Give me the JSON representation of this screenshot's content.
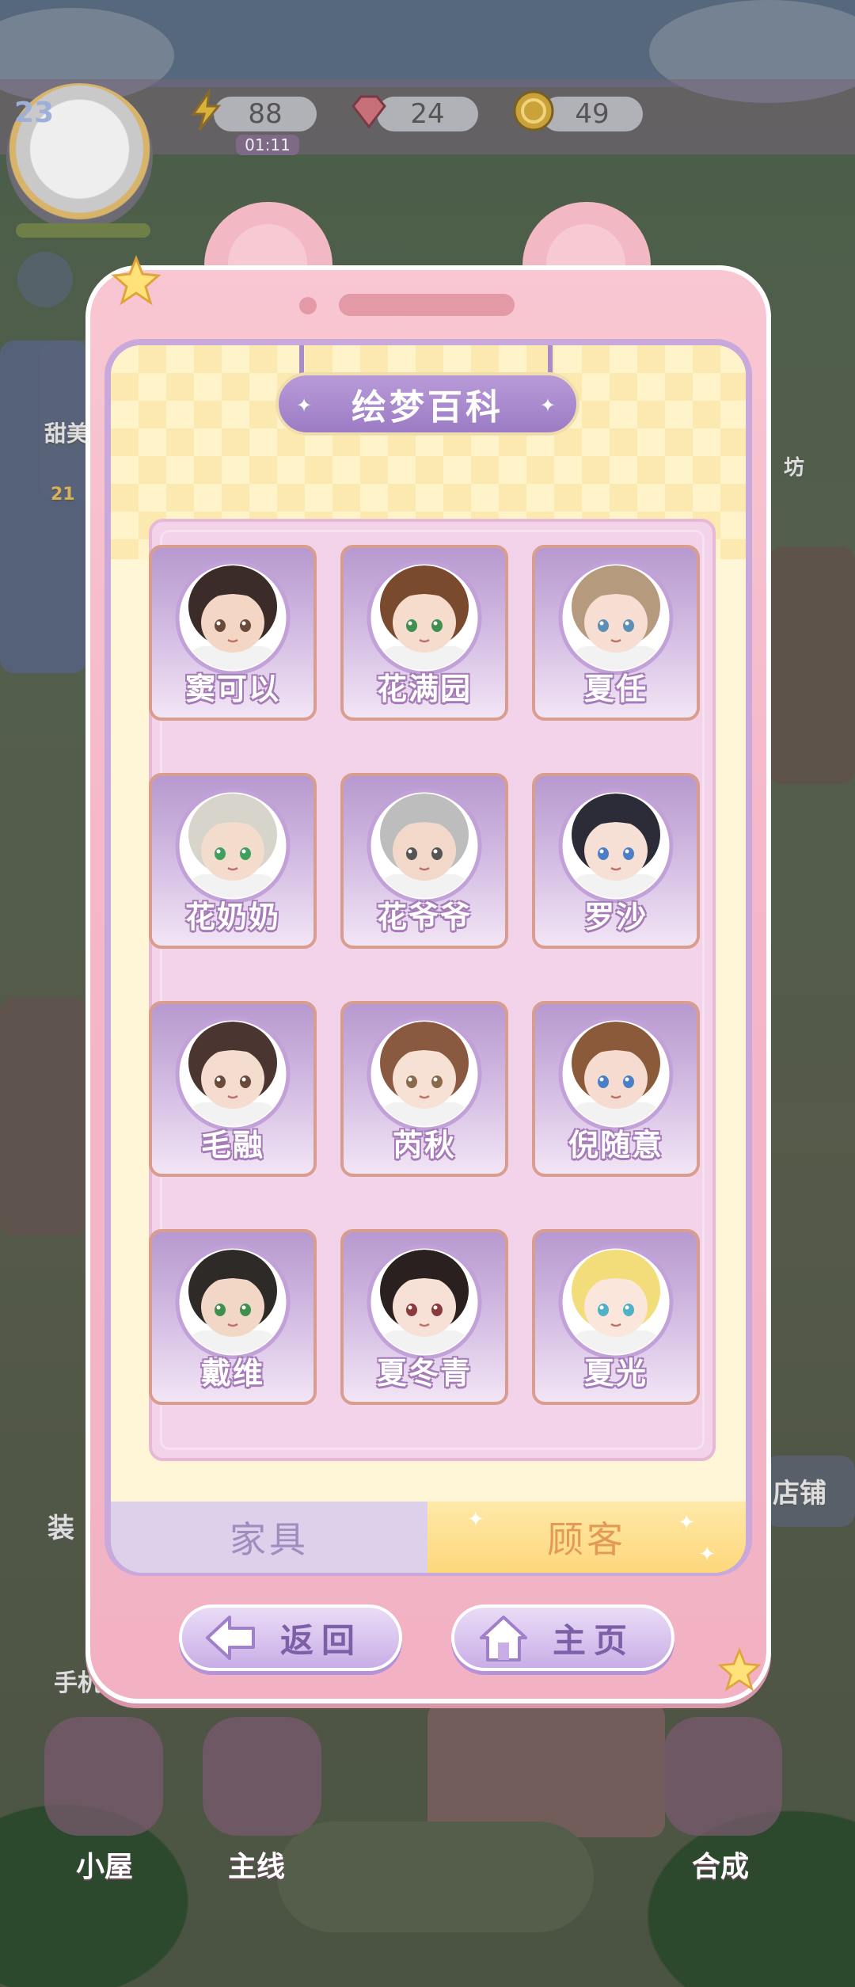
{
  "hud": {
    "level": "23",
    "energy": "88",
    "energy_timer": "01:11",
    "gems": "24",
    "coins": "49"
  },
  "background_labels": {
    "left_shop": "甜美",
    "left_count": "21",
    "right_workshop": "坊",
    "decorate": "装",
    "phone": "手机",
    "shop_button": "店铺",
    "house": "小屋",
    "main_quest": "主线",
    "merge": "合成"
  },
  "encyclopedia": {
    "title": "绘梦百科",
    "characters": [
      {
        "name": "窦可以",
        "hair": "#3b2c2a",
        "skin": "#f3d6c4",
        "eyes": "#6a4a3a"
      },
      {
        "name": "花满园",
        "hair": "#7a4a2e",
        "skin": "#f6dccd",
        "eyes": "#3f8f4f"
      },
      {
        "name": "夏任",
        "hair": "#b59a7e",
        "skin": "#f6dfd2",
        "eyes": "#5b8fb6"
      },
      {
        "name": "花奶奶",
        "hair": "#d7d4cc",
        "skin": "#f4dccd",
        "eyes": "#3f9f5f"
      },
      {
        "name": "花爷爷",
        "hair": "#bdbdbd",
        "skin": "#f2d8c8",
        "eyes": "#555555"
      },
      {
        "name": "罗沙",
        "hair": "#2c2c38",
        "skin": "#f6dfd4",
        "eyes": "#4a7fc6"
      },
      {
        "name": "毛融",
        "hair": "#4a3530",
        "skin": "#f4dccf",
        "eyes": "#6a4a3a"
      },
      {
        "name": "芮秋",
        "hair": "#8a5a40",
        "skin": "#f7e0d4",
        "eyes": "#8a6a4a"
      },
      {
        "name": "倪随意",
        "hair": "#8a5a3a",
        "skin": "#f6dcd0",
        "eyes": "#4a7fc6"
      },
      {
        "name": "戴维",
        "hair": "#2e2a28",
        "skin": "#f3d7c6",
        "eyes": "#3f8f4f"
      },
      {
        "name": "夏冬青",
        "hair": "#2a2020",
        "skin": "#f7e0d6",
        "eyes": "#8a3a3a"
      },
      {
        "name": "夏光",
        "hair": "#f3dc7a",
        "skin": "#fae6da",
        "eyes": "#4fb0c6"
      }
    ],
    "tabs": {
      "furniture": "家具",
      "customer": "顾客"
    },
    "buttons": {
      "back": "返回",
      "home": "主页"
    }
  },
  "colors": {
    "phone_pink": "#f5b8c8",
    "panel_lilac": "#c9a9dc",
    "name_outline": "#a67bb8",
    "active_tab": "#fdd77c"
  },
  "icons": [
    "energy-icon",
    "gem-icon",
    "coin-icon",
    "mail-icon",
    "back-arrow-icon",
    "home-icon",
    "star-icon"
  ]
}
